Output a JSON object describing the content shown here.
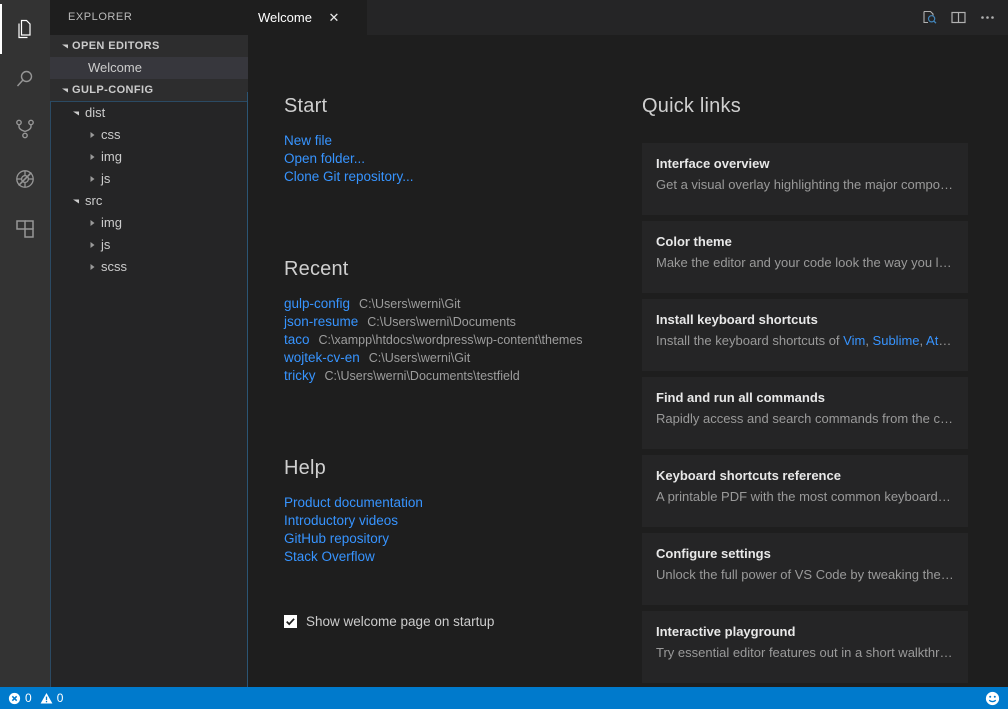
{
  "activity_bar": {
    "items": [
      {
        "name": "explorer",
        "icon": "files-icon",
        "active": true
      },
      {
        "name": "search",
        "icon": "search-icon",
        "active": false
      },
      {
        "name": "source-control",
        "icon": "source-control-icon",
        "active": false
      },
      {
        "name": "debug",
        "icon": "debug-icon",
        "active": false
      },
      {
        "name": "extensions",
        "icon": "extensions-icon",
        "active": false
      }
    ]
  },
  "sidebar": {
    "title": "EXPLORER",
    "open_editors": {
      "header": "OPEN EDITORS",
      "items": [
        {
          "label": "Welcome"
        }
      ]
    },
    "folder": {
      "header": "GULP-CONFIG",
      "tree": [
        {
          "label": "dist",
          "depth": 0,
          "expanded": true
        },
        {
          "label": "css",
          "depth": 1,
          "expanded": false
        },
        {
          "label": "img",
          "depth": 1,
          "expanded": false
        },
        {
          "label": "js",
          "depth": 1,
          "expanded": false
        },
        {
          "label": "src",
          "depth": 0,
          "expanded": true
        },
        {
          "label": "img",
          "depth": 1,
          "expanded": false
        },
        {
          "label": "js",
          "depth": 1,
          "expanded": false
        },
        {
          "label": "scss",
          "depth": 1,
          "expanded": false
        }
      ]
    }
  },
  "tabs": {
    "active": "Welcome",
    "items": [
      {
        "label": "Welcome",
        "close": "✕"
      }
    ],
    "actions": [
      {
        "name": "open-preview-icon"
      },
      {
        "name": "split-editor-icon"
      },
      {
        "name": "more-actions-icon"
      }
    ]
  },
  "welcome": {
    "start": {
      "title": "Start",
      "links": [
        {
          "label": "New file"
        },
        {
          "label": "Open folder..."
        },
        {
          "label": "Clone Git repository..."
        }
      ]
    },
    "recent": {
      "title": "Recent",
      "items": [
        {
          "name": "gulp-config",
          "path": "C:\\Users\\werni\\Git"
        },
        {
          "name": "json-resume",
          "path": "C:\\Users\\werni\\Documents"
        },
        {
          "name": "taco",
          "path": "C:\\xampp\\htdocs\\wordpress\\wp-content\\themes"
        },
        {
          "name": "wojtek-cv-en",
          "path": "C:\\Users\\werni\\Git"
        },
        {
          "name": "tricky",
          "path": "C:\\Users\\werni\\Documents\\testfield"
        }
      ]
    },
    "help": {
      "title": "Help",
      "links": [
        {
          "label": "Product documentation"
        },
        {
          "label": "Introductory videos"
        },
        {
          "label": "GitHub repository"
        },
        {
          "label": "Stack Overflow"
        }
      ]
    },
    "startup_checkbox": {
      "label": "Show welcome page on startup",
      "checked": true
    },
    "quick_links": {
      "title": "Quick links",
      "cards": [
        {
          "title": "Interface overview",
          "desc": "Get a visual overlay highlighting the major componen…"
        },
        {
          "title": "Color theme",
          "desc": "Make the editor and your code look the way you love"
        },
        {
          "title": "Install keyboard shortcuts",
          "desc_prefix": "Install the keyboard shortcuts of ",
          "desc_links": [
            "Vim",
            "Sublime",
            "Atom…"
          ],
          "desc": "Install the keyboard shortcuts of Vim, Sublime, Atom…"
        },
        {
          "title": "Find and run all commands",
          "desc": "Rapidly access and search commands from the contr…"
        },
        {
          "title": "Keyboard shortcuts reference",
          "desc": "A printable PDF with the most common keyboard sho…"
        },
        {
          "title": "Configure settings",
          "desc": "Unlock the full power of VS Code by tweaking the set…"
        },
        {
          "title": "Interactive playground",
          "desc": "Try essential editor features out in a short walkthrough"
        }
      ]
    }
  },
  "status_bar": {
    "errors": "0",
    "warnings": "0",
    "feedback_icon": "smiley-icon"
  },
  "colors": {
    "accent": "#007acc",
    "link": "#3794ff",
    "editor_bg": "#1e1e1e",
    "sidebar_bg": "#252526",
    "activity_bg": "#333333",
    "card_bg": "#252526"
  }
}
